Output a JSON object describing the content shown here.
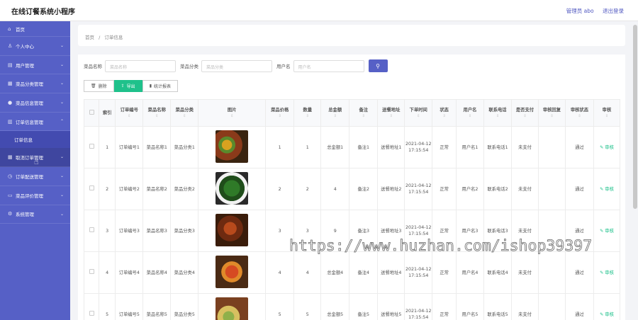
{
  "header": {
    "title": "在线订餐系统小程序",
    "role_label": "管理员 abo",
    "logout": "退出登录"
  },
  "sidebar": {
    "items": [
      {
        "label": "首页",
        "icon": "home-icon",
        "glyph": "⌂",
        "expandable": false
      },
      {
        "label": "个人中心",
        "icon": "user-icon",
        "glyph": "♙",
        "expandable": true
      },
      {
        "label": "用户管理",
        "icon": "users-icon",
        "glyph": "▤",
        "expandable": true
      },
      {
        "label": "菜品分类管理",
        "icon": "category-icon",
        "glyph": "▦",
        "expandable": true
      },
      {
        "label": "菜品信息管理",
        "icon": "location-icon",
        "glyph": "●",
        "expandable": true
      },
      {
        "label": "订单信息管理",
        "icon": "order-icon",
        "glyph": "▥",
        "expandable": true,
        "open": true,
        "sub": "订单信息"
      },
      {
        "label": "取消订单管理",
        "icon": "grid-icon",
        "glyph": "▦",
        "expandable": true
      },
      {
        "label": "订单配送管理",
        "icon": "delivery-icon",
        "glyph": "◷",
        "expandable": true
      },
      {
        "label": "菜品评价管理",
        "icon": "comment-icon",
        "glyph": "▭",
        "expandable": true
      },
      {
        "label": "系统管理",
        "icon": "settings-icon",
        "glyph": "⚙",
        "expandable": true
      }
    ]
  },
  "breadcrumb": {
    "home": "首页",
    "sep": "/",
    "current": "订单信息"
  },
  "filters": [
    {
      "label": "菜品名称",
      "placeholder": "菜品名称"
    },
    {
      "label": "菜品分类",
      "placeholder": "菜品分类"
    },
    {
      "label": "用户名",
      "placeholder": "用户名"
    }
  ],
  "actions": {
    "delete": "删除",
    "export": "导出",
    "report": "统计报表"
  },
  "table": {
    "headers": [
      "",
      "索引",
      "订单编号",
      "菜品名称",
      "菜品分类",
      "图片",
      "菜品价格",
      "数量",
      "总金额",
      "备注",
      "送餐地址",
      "下单时间",
      "状态",
      "用户名",
      "联系电话",
      "是否支付",
      "审核回复",
      "审核状态",
      "审核"
    ],
    "rows": [
      {
        "idx": "1",
        "order_no": "订单编号1",
        "dish": "菜品名称1",
        "cat": "菜品分类1",
        "price": "1",
        "qty": "1",
        "total": "总金额1",
        "note": "备注1",
        "addr": "送餐地址1",
        "time": "2021-04-12 17:15:54",
        "status": "正常",
        "user": "用户名1",
        "phone": "联系电话1",
        "paid": "未支付",
        "reply": "",
        "audit": "通过",
        "op": "审核"
      },
      {
        "idx": "2",
        "order_no": "订单编号2",
        "dish": "菜品名称2",
        "cat": "菜品分类2",
        "price": "2",
        "qty": "2",
        "total": "4",
        "note": "备注2",
        "addr": "送餐地址2",
        "time": "2021-04-12 17:15:54",
        "status": "正常",
        "user": "用户名2",
        "phone": "联系电话2",
        "paid": "未支付",
        "reply": "",
        "audit": "通过",
        "op": "审核"
      },
      {
        "idx": "3",
        "order_no": "订单编号3",
        "dish": "菜品名称3",
        "cat": "菜品分类3",
        "price": "3",
        "qty": "3",
        "total": "9",
        "note": "备注3",
        "addr": "送餐地址3",
        "time": "2021-04-12 17:15:54",
        "status": "正常",
        "user": "用户名3",
        "phone": "联系电话3",
        "paid": "未支付",
        "reply": "",
        "audit": "通过",
        "op": "审核"
      },
      {
        "idx": "4",
        "order_no": "订单编号4",
        "dish": "菜品名称4",
        "cat": "菜品分类4",
        "price": "4",
        "qty": "4",
        "total": "总金额4",
        "note": "备注4",
        "addr": "送餐地址4",
        "time": "2021-04-12 17:15:54",
        "status": "正常",
        "user": "用户名4",
        "phone": "联系电话4",
        "paid": "未支付",
        "reply": "",
        "audit": "通过",
        "op": "审核"
      },
      {
        "idx": "5",
        "order_no": "订单编号5",
        "dish": "菜品名称5",
        "cat": "菜品分类5",
        "price": "5",
        "qty": "5",
        "total": "总金额5",
        "note": "备注5",
        "addr": "送餐地址5",
        "time": "2021-04-12 17:15:54",
        "status": "正常",
        "user": "用户名5",
        "phone": "联系电话5",
        "paid": "未支付",
        "reply": "",
        "audit": "通过",
        "op": "审核"
      }
    ]
  },
  "watermark": "https://www.huzhan.com/ishop39397",
  "colors": {
    "sidebar": "#5660c6",
    "accent_green": "#1fc18b",
    "primary": "#5660c6"
  }
}
